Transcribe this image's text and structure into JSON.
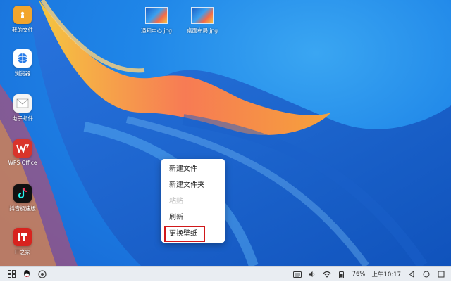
{
  "desktop_icons": [
    {
      "label": "我的文件",
      "icon": "folder-icon"
    },
    {
      "label": "浏览器",
      "icon": "browser-icon"
    },
    {
      "label": "电子邮件",
      "icon": "mail-icon"
    },
    {
      "label": "WPS Office",
      "icon": "wps-icon"
    },
    {
      "label": "抖音极速版",
      "icon": "douyin-icon"
    },
    {
      "label": "IT之家",
      "icon": "ithome-icon"
    }
  ],
  "desktop_files": [
    {
      "label": "通知中心.jpg",
      "icon": "image-file-icon"
    },
    {
      "label": "桌面布局.jpg",
      "icon": "image-file-icon"
    }
  ],
  "context_menu": {
    "items": [
      {
        "label": "新建文件",
        "enabled": true
      },
      {
        "label": "新建文件夹",
        "enabled": true
      },
      {
        "label": "粘贴",
        "enabled": false
      },
      {
        "label": "刷新",
        "enabled": true
      },
      {
        "label": "更换壁纸",
        "enabled": true,
        "highlighted": true
      }
    ]
  },
  "taskbar": {
    "left_icons": [
      "app-launcher-icon",
      "qq-icon",
      "chrome-icon"
    ],
    "battery": "76%",
    "time": "上午10:17",
    "right_icons": [
      "keyboard-icon",
      "volume-icon",
      "wifi-icon",
      "battery-icon",
      "back-icon",
      "home-icon",
      "recents-icon"
    ]
  },
  "colors": {
    "highlight_border": "#d0181a",
    "wps": "#d9342b",
    "douyin": "#111111",
    "ithome": "#d8231e",
    "folder": "#f2a52d"
  }
}
